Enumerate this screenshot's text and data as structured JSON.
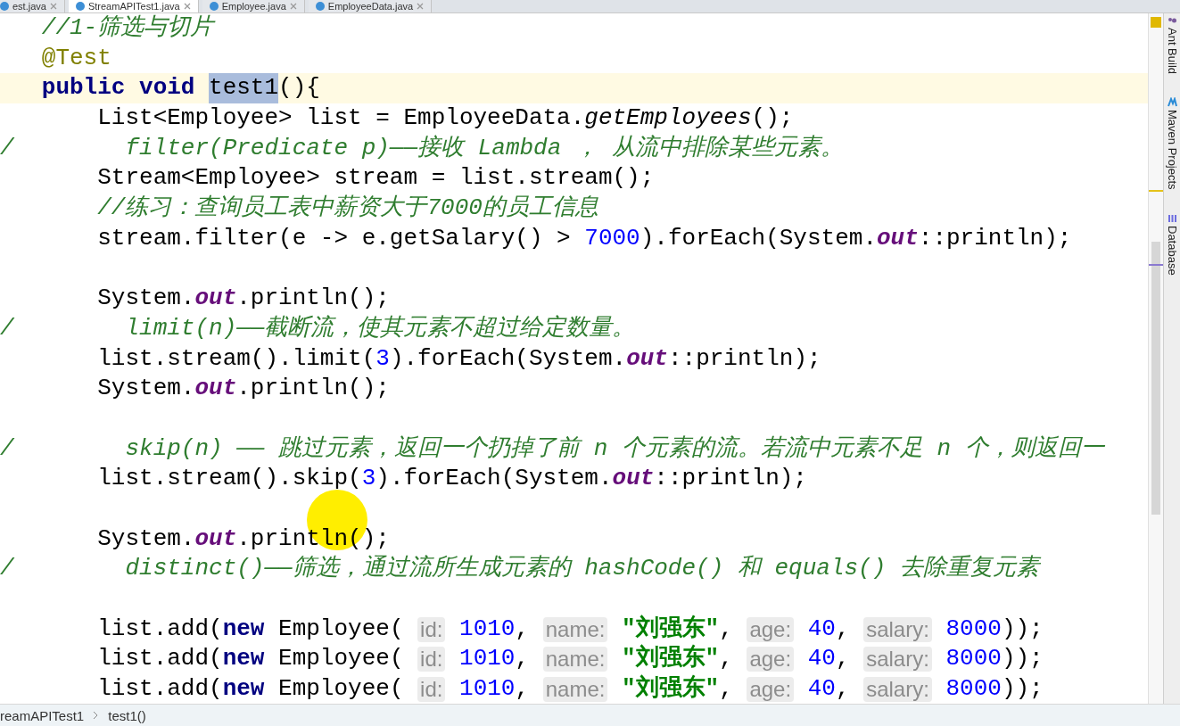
{
  "tabs": [
    {
      "label": "est.java",
      "selected": false
    },
    {
      "label": "StreamAPITest1.java",
      "selected": true
    },
    {
      "label": "Employee.java",
      "selected": false
    },
    {
      "label": "EmployeeData.java",
      "selected": false
    }
  ],
  "editor": {
    "lines": [
      {
        "current": false,
        "segments": [
          {
            "text": "   //1-筛选与切片",
            "kind": "comment"
          }
        ]
      },
      {
        "current": false,
        "segments": [
          {
            "text": "   @Test",
            "kind": "annotation"
          }
        ]
      },
      {
        "current": true,
        "segments": [
          {
            "text": "   public void ",
            "kind": "keyword"
          },
          {
            "text": "test1",
            "kind": "selection"
          },
          {
            "text": "(){",
            "kind": "plain"
          }
        ]
      },
      {
        "current": false,
        "segments": [
          {
            "text": "       List<Employee> list = EmployeeData.",
            "kind": "plain"
          },
          {
            "text": "getEmployees",
            "kind": "static_method"
          },
          {
            "text": "();",
            "kind": "plain"
          }
        ]
      },
      {
        "current": false,
        "segments": [
          {
            "text": "/        filter(Predicate p)——接收 Lambda ， 从流中排除某些元素。",
            "kind": "comment"
          }
        ]
      },
      {
        "current": false,
        "segments": [
          {
            "text": "       Stream<Employee> stream = list.stream();",
            "kind": "plain"
          }
        ]
      },
      {
        "current": false,
        "segments": [
          {
            "text": "       //练习：查询员工表中薪资大于7000的员工信息",
            "kind": "comment"
          }
        ]
      },
      {
        "current": false,
        "segments": [
          {
            "text": "       stream.filter(e -> e.getSalary() > ",
            "kind": "plain"
          },
          {
            "text": "7000",
            "kind": "number"
          },
          {
            "text": ").forEach(System.",
            "kind": "plain"
          },
          {
            "text": "out",
            "kind": "static_field"
          },
          {
            "text": "::println);",
            "kind": "plain"
          }
        ]
      },
      {
        "current": false
      },
      {
        "current": false,
        "segments": [
          {
            "text": "       System.",
            "kind": "plain"
          },
          {
            "text": "out",
            "kind": "static_field"
          },
          {
            "text": ".println();",
            "kind": "plain"
          }
        ]
      },
      {
        "current": false,
        "segments": [
          {
            "text": "/        limit(n)——截断流，使其元素不超过给定数量。",
            "kind": "comment"
          }
        ]
      },
      {
        "current": false,
        "segments": [
          {
            "text": "       list.stream().limit(",
            "kind": "plain"
          },
          {
            "text": "3",
            "kind": "number"
          },
          {
            "text": ").forEach(System.",
            "kind": "plain"
          },
          {
            "text": "out",
            "kind": "static_field"
          },
          {
            "text": "::println);",
            "kind": "plain"
          }
        ]
      },
      {
        "current": false,
        "segments": [
          {
            "text": "       System.",
            "kind": "plain"
          },
          {
            "text": "out",
            "kind": "static_field"
          },
          {
            "text": ".println();",
            "kind": "plain"
          }
        ]
      },
      {
        "current": false
      },
      {
        "current": false,
        "segments": [
          {
            "text": "/        skip(n) —— 跳过元素，返回一个扔掉了前 n 个元素的流。若流中元素不足 n 个，则返回一",
            "kind": "comment"
          }
        ]
      },
      {
        "current": false,
        "segments": [
          {
            "text": "       list.stream().skip(",
            "kind": "plain"
          },
          {
            "text": "3",
            "kind": "number"
          },
          {
            "text": ").forEach(System.",
            "kind": "plain"
          },
          {
            "text": "out",
            "kind": "static_field"
          },
          {
            "text": "::println);",
            "kind": "plain"
          }
        ]
      },
      {
        "current": false
      },
      {
        "current": false,
        "segments": [
          {
            "text": "       System.",
            "kind": "plain"
          },
          {
            "text": "out",
            "kind": "static_field"
          },
          {
            "text": ".println();",
            "kind": "plain"
          }
        ]
      },
      {
        "current": false,
        "segments": [
          {
            "text": "/        distinct()——筛选，通过流所生成元素的 hashCode() 和 equals() 去除重复元素",
            "kind": "comment"
          }
        ]
      },
      {
        "current": false
      },
      {
        "current": false,
        "segments": [
          {
            "text": "       list.add(",
            "kind": "plain"
          },
          {
            "text": "new",
            "kind": "keyword"
          },
          {
            "text": " Employee( ",
            "kind": "plain"
          },
          {
            "text": "id:",
            "kind": "hint"
          },
          {
            "text": " 1010",
            "kind": "number"
          },
          {
            "text": ", ",
            "kind": "plain"
          },
          {
            "text": "name:",
            "kind": "hint"
          },
          {
            "text": " \"刘强东\"",
            "kind": "string"
          },
          {
            "text": ", ",
            "kind": "plain"
          },
          {
            "text": "age:",
            "kind": "hint"
          },
          {
            "text": " 40",
            "kind": "number"
          },
          {
            "text": ", ",
            "kind": "plain"
          },
          {
            "text": "salary:",
            "kind": "hint"
          },
          {
            "text": " 8000",
            "kind": "number"
          },
          {
            "text": "));",
            "kind": "plain"
          }
        ]
      },
      {
        "current": false,
        "segments": [
          {
            "text": "       list.add(",
            "kind": "plain"
          },
          {
            "text": "new",
            "kind": "keyword"
          },
          {
            "text": " Employee( ",
            "kind": "plain"
          },
          {
            "text": "id:",
            "kind": "hint"
          },
          {
            "text": " 1010",
            "kind": "number"
          },
          {
            "text": ", ",
            "kind": "plain"
          },
          {
            "text": "name:",
            "kind": "hint"
          },
          {
            "text": " \"刘强东\"",
            "kind": "string"
          },
          {
            "text": ", ",
            "kind": "plain"
          },
          {
            "text": "age:",
            "kind": "hint"
          },
          {
            "text": " 40",
            "kind": "number"
          },
          {
            "text": ", ",
            "kind": "plain"
          },
          {
            "text": "salary:",
            "kind": "hint"
          },
          {
            "text": " 8000",
            "kind": "number"
          },
          {
            "text": "));",
            "kind": "plain"
          }
        ]
      },
      {
        "current": false,
        "segments": [
          {
            "text": "       list.add(",
            "kind": "plain"
          },
          {
            "text": "new",
            "kind": "keyword"
          },
          {
            "text": " Employee( ",
            "kind": "plain"
          },
          {
            "text": "id:",
            "kind": "hint"
          },
          {
            "text": " 1010",
            "kind": "number"
          },
          {
            "text": ", ",
            "kind": "plain"
          },
          {
            "text": "name:",
            "kind": "hint"
          },
          {
            "text": " \"刘强东\"",
            "kind": "string"
          },
          {
            "text": ", ",
            "kind": "plain"
          },
          {
            "text": "age:",
            "kind": "hint"
          },
          {
            "text": " 40",
            "kind": "number"
          },
          {
            "text": ", ",
            "kind": "plain"
          },
          {
            "text": "salary:",
            "kind": "hint"
          },
          {
            "text": " 8000",
            "kind": "number"
          },
          {
            "text": "));",
            "kind": "plain"
          }
        ]
      }
    ]
  },
  "tool_windows": [
    {
      "label": "Ant Build",
      "kind": "ant"
    },
    {
      "label": "Maven Projects",
      "kind": "maven"
    },
    {
      "label": "Database",
      "kind": "database"
    }
  ],
  "breadcrumb": [
    "reamAPITest1",
    "test1()"
  ]
}
